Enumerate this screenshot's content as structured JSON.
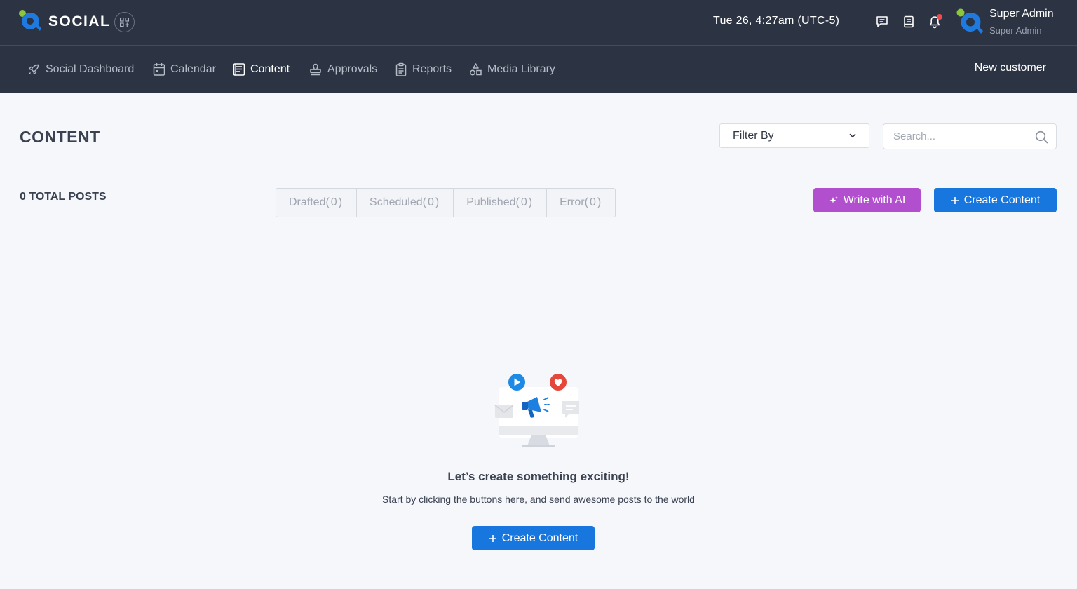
{
  "app": {
    "brand": "SOCIAL",
    "datetime": "Tue 26, 4:27am (UTC-5)",
    "user": {
      "name": "Super Admin",
      "role": "Super Admin"
    }
  },
  "nav": {
    "items": [
      {
        "label": "Social Dashboard",
        "icon": "rocket-icon",
        "active": false
      },
      {
        "label": "Calendar",
        "icon": "calendar-icon",
        "active": false
      },
      {
        "label": "Content",
        "icon": "document-icon",
        "active": true
      },
      {
        "label": "Approvals",
        "icon": "stamp-icon",
        "active": false
      },
      {
        "label": "Reports",
        "icon": "clipboard-icon",
        "active": false
      },
      {
        "label": "Media Library",
        "icon": "shapes-icon",
        "active": false
      }
    ],
    "right_link": "New customer"
  },
  "content": {
    "title": "CONTENT",
    "filter": {
      "selected": "Filter By"
    },
    "search": {
      "placeholder": "Search..."
    },
    "total_posts": "0 TOTAL POSTS",
    "tabs": [
      {
        "label": "Drafted",
        "count": "(0)"
      },
      {
        "label": "Scheduled",
        "count": "(0)"
      },
      {
        "label": "Published",
        "count": "(0)"
      },
      {
        "label": "Error",
        "count": "(0)"
      }
    ],
    "write_ai_label": "Write with AI",
    "create_label": "Create Content"
  },
  "empty_state": {
    "title": "Let’s create something exciting!",
    "subtitle": "Start by clicking the buttons here, and send awesome posts to the world",
    "button_label": "Create Content"
  },
  "colors": {
    "header_bg": "#2c3342",
    "primary": "#1877de",
    "ai_purple": "#b24fce",
    "notification": "#f04b4b",
    "logo_green": "#8cc63f",
    "logo_blue": "#1f7ae0"
  }
}
